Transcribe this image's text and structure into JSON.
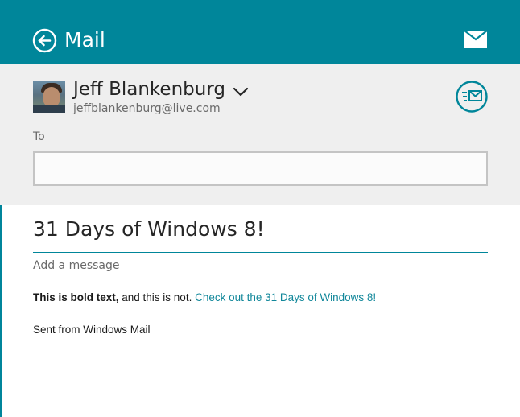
{
  "app": {
    "title": "Mail",
    "accent_color": "#00869a",
    "back_icon": "back-arrow-circle-icon",
    "mail_icon": "envelope-icon"
  },
  "sender": {
    "name": "Jeff Blankenburg",
    "email": "jeffblankenburg@live.com",
    "avatar": "user-avatar-photo",
    "dropdown_icon": "chevron-down-icon"
  },
  "actions": {
    "send_icon": "send-mail-icon"
  },
  "to_field": {
    "label": "To",
    "value": "",
    "placeholder": ""
  },
  "subject": "31 Days of Windows 8!",
  "message": {
    "placeholder": "Add a message",
    "bold_text": "This is bold text,",
    "plain_text": " and this is not. ",
    "link_text": "Check out the 31 Days of Windows 8!",
    "link_color": "#11879a",
    "signature": "Sent from Windows Mail"
  }
}
